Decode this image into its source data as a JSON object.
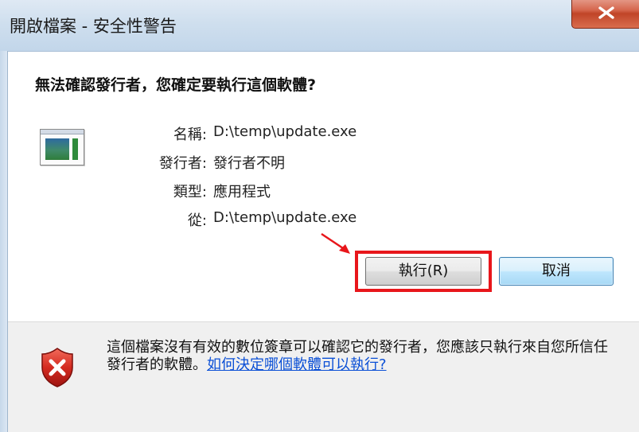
{
  "window": {
    "title": "開啟檔案 - 安全性警告",
    "close_glyph": "X"
  },
  "dialog": {
    "heading": "無法確認發行者，您確定要執行這個軟體?",
    "file_icon": "executable-window-icon",
    "details": [
      {
        "label": "名稱:",
        "value": "D:\\temp\\update.exe"
      },
      {
        "label": "發行者:",
        "value": "發行者不明"
      },
      {
        "label": "類型:",
        "value": "應用程式"
      },
      {
        "label": "從:",
        "value": "D:\\temp\\update.exe"
      }
    ]
  },
  "buttons": {
    "run_label": "執行(R)",
    "cancel_label": "取消"
  },
  "annotation": {
    "arrow_color": "#e8161b",
    "highlight_color": "#e8161b"
  },
  "footer": {
    "icon": "red-shield-x-icon",
    "warning_text": "這個檔案沒有有效的數位簽章可以確認它的發行者，您應該只執行來自您所信任發行者的軟體。",
    "link_text": "如何決定哪個軟體可以執行?"
  }
}
